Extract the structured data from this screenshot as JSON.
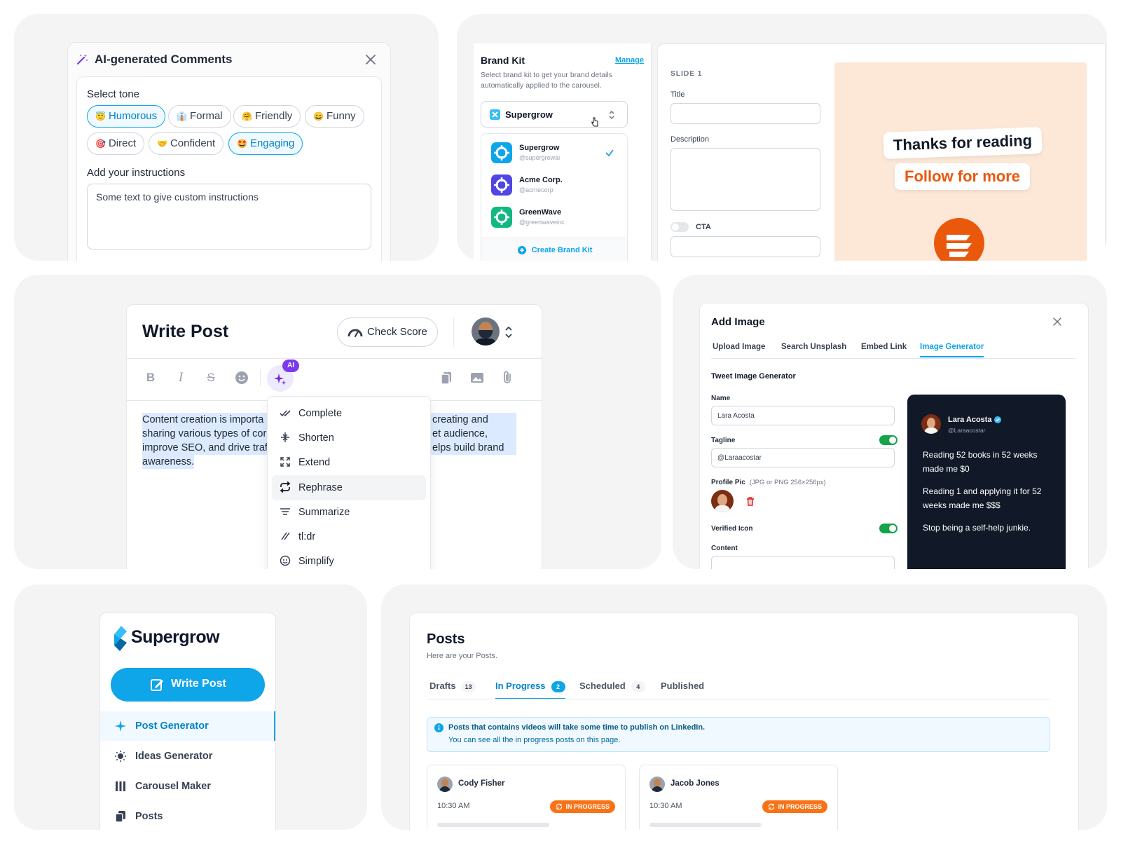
{
  "ai_comments": {
    "title": "AI-generated Comments",
    "select_tone_label": "Select tone",
    "tones": [
      {
        "emoji": "😇",
        "label": "Humorous",
        "selected": true
      },
      {
        "emoji": "👔",
        "label": "Formal",
        "selected": false
      },
      {
        "emoji": "🤗",
        "label": "Friendly",
        "selected": false
      },
      {
        "emoji": "😄",
        "label": "Funny",
        "selected": false
      },
      {
        "emoji": "🎯",
        "label": "Direct",
        "selected": false
      },
      {
        "emoji": "🤝",
        "label": "Confident",
        "selected": false
      },
      {
        "emoji": "🤩",
        "label": "Engaging",
        "selected": true
      }
    ],
    "instructions_label": "Add your instructions",
    "instructions_value": "Some text to give custom instructions"
  },
  "brand_kit": {
    "title": "Brand Kit",
    "manage_label": "Manage",
    "subtitle": "Select brand kit to get your brand details automatically applied to the carousel.",
    "selected": "Supergrow",
    "options": [
      {
        "name": "Supergrow",
        "handle": "@supergrowai",
        "color": "#0ea5e9",
        "checked": true
      },
      {
        "name": "Acme Corp.",
        "handle": "@acmecorp",
        "color": "#4f46e5",
        "checked": false
      },
      {
        "name": "GreenWave",
        "handle": "@greenwaveinc",
        "color": "#10b981",
        "checked": false
      }
    ],
    "create_label": "Create Brand Kit"
  },
  "slide": {
    "heading": "SLIDE 1",
    "title_label": "Title",
    "description_label": "Description",
    "cta_label": "CTA",
    "preview_line1": "Thanks for reading",
    "preview_line2": "Follow for more",
    "accent": "#ea580c"
  },
  "write_post": {
    "title": "Write Post",
    "check_score_label": "Check Score",
    "ai_badge": "AI",
    "content_left": [
      "Content creation is importa",
      "sharing various types of cor",
      "improve SEO, and drive traf",
      "awareness."
    ],
    "content_right": [
      "creating and",
      "et audience,",
      "elps build brand"
    ],
    "menu": [
      {
        "label": "Complete",
        "icon": "double-check-icon",
        "selected": false
      },
      {
        "label": "Shorten",
        "icon": "compress-icon",
        "selected": false
      },
      {
        "label": "Extend",
        "icon": "expand-icon",
        "selected": false
      },
      {
        "label": "Rephrase",
        "icon": "repeat-icon",
        "selected": true
      },
      {
        "label": "Summarize",
        "icon": "lines-icon",
        "selected": false
      },
      {
        "label": "tl:dr",
        "icon": "slash-icon",
        "selected": false
      },
      {
        "label": "Simplify",
        "icon": "smile-icon",
        "selected": false
      }
    ]
  },
  "add_image": {
    "title": "Add Image",
    "tabs": [
      {
        "label": "Upload Image",
        "active": false
      },
      {
        "label": "Search Unsplash",
        "active": false
      },
      {
        "label": "Embed Link",
        "active": false
      },
      {
        "label": "Image Generator",
        "active": true
      }
    ],
    "section_title": "Tweet Image Generator",
    "name_label": "Name",
    "name_value": "Lara Acosta",
    "tagline_label": "Tagline",
    "tagline_value": "@Laraacostar",
    "profile_pic_label": "Profile Pic",
    "profile_pic_hint": "(JPG or PNG 256×256px)",
    "verified_label": "Verified Icon",
    "content_label": "Content",
    "tweet": {
      "name": "Lara Acosta",
      "handle": "@Laraacostar",
      "paragraphs": [
        "Reading 52 books in 52 weeks made me $0",
        "Reading 1 and applying it for 52 weeks made me $$$",
        "Stop being a self-help junkie."
      ]
    }
  },
  "sidebar": {
    "brand": "Supergrow",
    "write_post_label": "Write Post",
    "items": [
      {
        "label": "Post Generator",
        "icon": "sparkle-icon",
        "active": true
      },
      {
        "label": "Ideas Generator",
        "icon": "bulb-icon",
        "active": false
      },
      {
        "label": "Carousel Maker",
        "icon": "columns-icon",
        "active": false
      },
      {
        "label": "Posts",
        "icon": "docs-icon",
        "active": false
      }
    ]
  },
  "posts": {
    "title": "Posts",
    "subtitle": "Here are your Posts.",
    "tabs": [
      {
        "label": "Drafts",
        "count": "13",
        "active": false
      },
      {
        "label": "In Progress",
        "count": "2",
        "active": true
      },
      {
        "label": "Scheduled",
        "count": "4",
        "active": false
      },
      {
        "label": "Published",
        "count": "",
        "active": false
      }
    ],
    "alert_title": "Posts that contains videos will take some time to publish on LinkedIn.",
    "alert_body": "You can see all the in progress posts on this page.",
    "cards": [
      {
        "author": "Cody Fisher",
        "time": "10:30 AM",
        "status": "IN PROGRESS"
      },
      {
        "author": "Jacob Jones",
        "time": "10:30 AM",
        "status": "IN PROGRESS"
      }
    ]
  }
}
